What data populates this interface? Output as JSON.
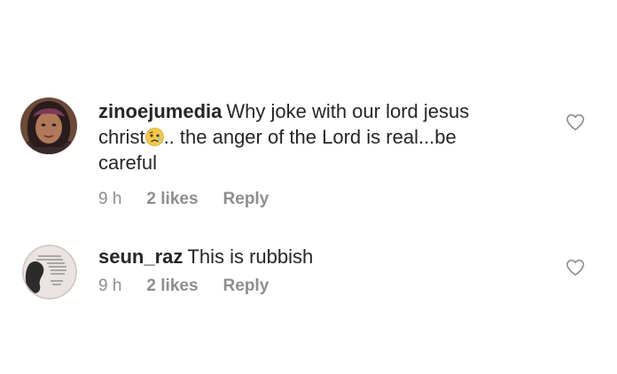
{
  "colors": {
    "text": "#262626",
    "meta": "#8e8e8e",
    "heart_stroke": "#8e8e8e"
  },
  "comments": [
    {
      "username": "zinoejumedia",
      "text_part1": "Why joke with our lord jesus christ",
      "emoji": "worried-face-emoji",
      "text_part2": ".. the anger of the Lord is real...be careful",
      "time": "9 h",
      "likes": "2 likes",
      "reply_label": "Reply"
    },
    {
      "username": "seun_raz",
      "text_part1": "This is rubbish",
      "time": "9 h",
      "likes": "2 likes",
      "reply_label": "Reply"
    }
  ]
}
